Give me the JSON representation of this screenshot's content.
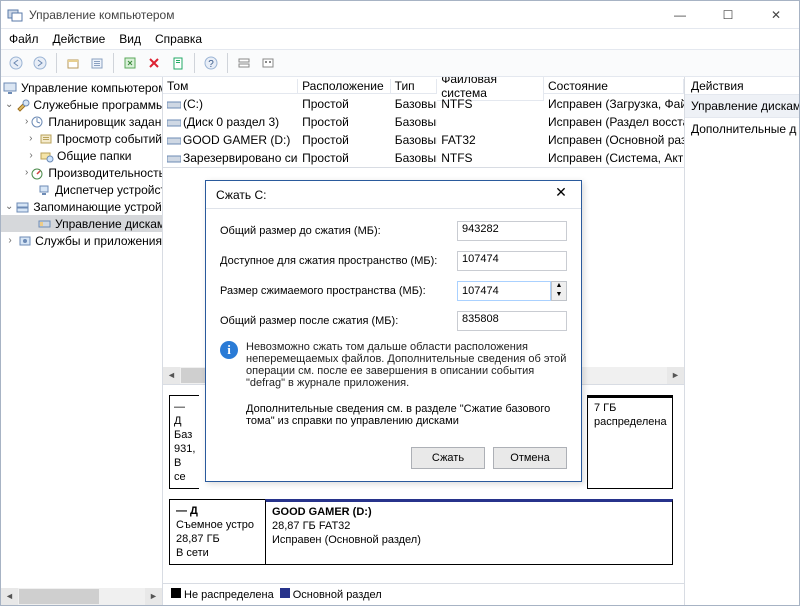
{
  "title": "Управление компьютером",
  "menubar": [
    "Файл",
    "Действие",
    "Вид",
    "Справка"
  ],
  "tree": {
    "root": "Управление компьютером (л",
    "groups": [
      {
        "label": "Служебные программы",
        "expanded": true,
        "items": [
          "Планировщик заданий",
          "Просмотр событий",
          "Общие папки",
          "Производительность",
          "Диспетчер устройств"
        ]
      },
      {
        "label": "Запоминающие устройст",
        "expanded": true,
        "items": [
          "Управление дисками"
        ],
        "selected_index": 0
      },
      {
        "label": "Службы и приложения",
        "expanded": false,
        "items": []
      }
    ]
  },
  "grid": {
    "headers": [
      "Том",
      "Расположение",
      "Тип",
      "Файловая система",
      "Состояние"
    ],
    "rows": [
      {
        "name": "(C:)",
        "layout": "Простой",
        "type": "Базовый",
        "fs": "NTFS",
        "state": "Исправен (Загрузка, Файл"
      },
      {
        "name": "(Диск 0 раздел 3)",
        "layout": "Простой",
        "type": "Базовый",
        "fs": "",
        "state": "Исправен (Раздел восстан"
      },
      {
        "name": "GOOD GAMER (D:)",
        "layout": "Простой",
        "type": "Базовый",
        "fs": "FAT32",
        "state": "Исправен (Основной разд"
      },
      {
        "name": "Зарезервировано системой",
        "layout": "Простой",
        "type": "Базовый",
        "fs": "NTFS",
        "state": "Исправен (Система, Актив"
      }
    ]
  },
  "disks": {
    "disk0": {
      "header_lines": [
        "— Д",
        "Баз",
        "931,",
        "В се"
      ],
      "unalloc_right": {
        "size": "7 ГБ",
        "state": "распределена"
      }
    },
    "disk1": {
      "header_lines": [
        "— Д",
        "Съемное устро",
        "28,87 ГБ",
        "В сети"
      ],
      "partition": {
        "name": "GOOD GAMER  (D:)",
        "size": "28,87 ГБ FAT32",
        "state": "Исправен (Основной раздел)"
      }
    }
  },
  "legend": {
    "a": "Не распределена",
    "b": "Основной раздел"
  },
  "actions": {
    "header": "Действия",
    "item1": "Управление дисками",
    "item2": "Дополнительные д"
  },
  "dialog": {
    "title": "Сжать C:",
    "labels": {
      "total_before": "Общий размер до сжатия (МБ):",
      "available": "Доступное для сжатия пространство (МБ):",
      "shrink": "Размер сжимаемого пространства (МБ):",
      "total_after": "Общий размер после сжатия (МБ):"
    },
    "values": {
      "total_before": "943282",
      "available": "107474",
      "shrink": "107474",
      "total_after": "835808"
    },
    "info1": "Невозможно сжать том дальше области расположения неперемещаемых файлов. Дополнительные сведения об этой операции см. после ее завершения в описании события \"defrag\" в журнале приложения.",
    "info2": "Дополнительные сведения см. в разделе \"Сжатие базового тома\" из справки по управлению дисками",
    "buttons": {
      "ok": "Сжать",
      "cancel": "Отмена"
    }
  }
}
